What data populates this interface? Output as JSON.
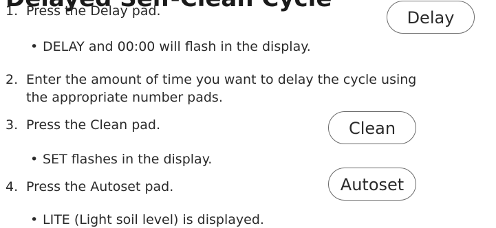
{
  "heading": "Delayed Self-Clean Cycle",
  "steps": [
    {
      "num": "1.",
      "text": "Press the Delay pad."
    },
    {
      "num": "2.",
      "text": "Enter the amount of time you want to delay the cycle using",
      "text2": "the appropriate number pads."
    },
    {
      "num": "3.",
      "text": "Press the Clean pad."
    },
    {
      "num": "4.",
      "text": "Press the Autoset pad."
    }
  ],
  "subs": [
    {
      "bullet": "•",
      "text": "DELAY and 00:00 will flash in the display."
    },
    {
      "bullet": "•",
      "text": "SET flashes in the display."
    },
    {
      "bullet": "•",
      "text": "LITE (Light soil level) is displayed."
    }
  ],
  "pads": {
    "delay": "Delay",
    "clean": "Clean",
    "autoset": "Autoset"
  }
}
